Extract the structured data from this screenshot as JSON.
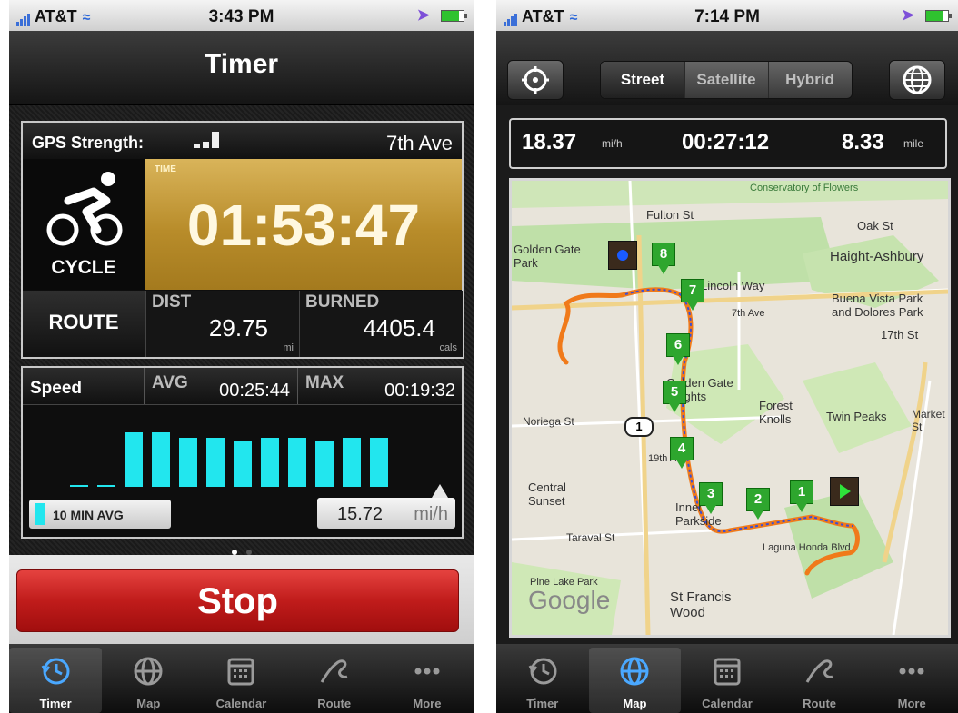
{
  "colors": {
    "accent_cyan": "#22e6ee",
    "stop_red": "#c01c1b",
    "timer_gold": "#b88c2a",
    "route_orange": "#f07a1a",
    "marker_green": "#2ea62e"
  },
  "left_phone": {
    "status": {
      "carrier": "AT&T",
      "time": "3:43 PM"
    },
    "title": "Timer",
    "gps": {
      "label": "GPS Strength:",
      "street": "7th Ave",
      "signal_bars_filled": 3
    },
    "activity": {
      "icon": "cyclist-icon",
      "label": "CYCLE"
    },
    "time": {
      "caption": "TIME",
      "value": "01:53:47"
    },
    "route_button": "ROUTE",
    "dist": {
      "label": "DIST",
      "value": "29.75",
      "unit": "mi"
    },
    "burned": {
      "label": "BURNED",
      "value": "4405.4",
      "unit": "cals"
    },
    "speed": {
      "label": "Speed",
      "avg_label": "AVG",
      "avg_value": "00:25:44",
      "max_label": "MAX",
      "max_value": "00:19:32",
      "bar_levels": [
        0.02,
        0.02,
        0.67,
        0.67,
        0.6,
        0.6,
        0.55,
        0.6,
        0.6,
        0.55,
        0.6,
        0.6
      ],
      "avg_button": "10 MIN AVG",
      "current_value": "15.72",
      "current_unit": "mi/h"
    },
    "page_dots": 2,
    "stop_button": "Stop",
    "tabs": [
      {
        "label": "Timer",
        "icon": "clock-icon",
        "active": true
      },
      {
        "label": "Map",
        "icon": "globe-icon",
        "active": false
      },
      {
        "label": "Calendar",
        "icon": "calendar-icon",
        "active": false
      },
      {
        "label": "Route",
        "icon": "route-icon",
        "active": false
      },
      {
        "label": "More",
        "icon": "more-icon",
        "active": false
      }
    ]
  },
  "right_phone": {
    "status": {
      "carrier": "AT&T",
      "time": "7:14 PM"
    },
    "map_types": [
      "Street",
      "Satellite",
      "Hybrid"
    ],
    "selected_map_type": "Street",
    "speed": {
      "value": "18.37",
      "unit": "mi/h"
    },
    "elapsed": "00:27:12",
    "distance": {
      "value": "8.33",
      "unit": "mile"
    },
    "map_labels": [
      "Fulton St",
      "Conservatory of Flowers",
      "Oak St",
      "Golden Gate Park",
      "Haight-Ashbury",
      "Lincoln Way",
      "Buena Vista Park and Dolores Park",
      "17th St",
      "7th Ave",
      "Golden Gate Heights",
      "Forest Knolls",
      "Twin Peaks",
      "Noriega St",
      "Market St",
      "Central Sunset",
      "19th Ave",
      "Inner Parkside",
      "Taraval St",
      "Laguna Honda Blvd",
      "Pine Lake Park",
      "St Francis Wood",
      "Google"
    ],
    "route_markers": [
      "1",
      "2",
      "3",
      "4",
      "5",
      "6",
      "7",
      "8"
    ],
    "highway_shield": "1",
    "tabs": [
      {
        "label": "Timer",
        "icon": "clock-icon",
        "active": false
      },
      {
        "label": "Map",
        "icon": "globe-icon",
        "active": true
      },
      {
        "label": "Calendar",
        "icon": "calendar-icon",
        "active": false
      },
      {
        "label": "Route",
        "icon": "route-icon",
        "active": false
      },
      {
        "label": "More",
        "icon": "more-icon",
        "active": false
      }
    ]
  }
}
